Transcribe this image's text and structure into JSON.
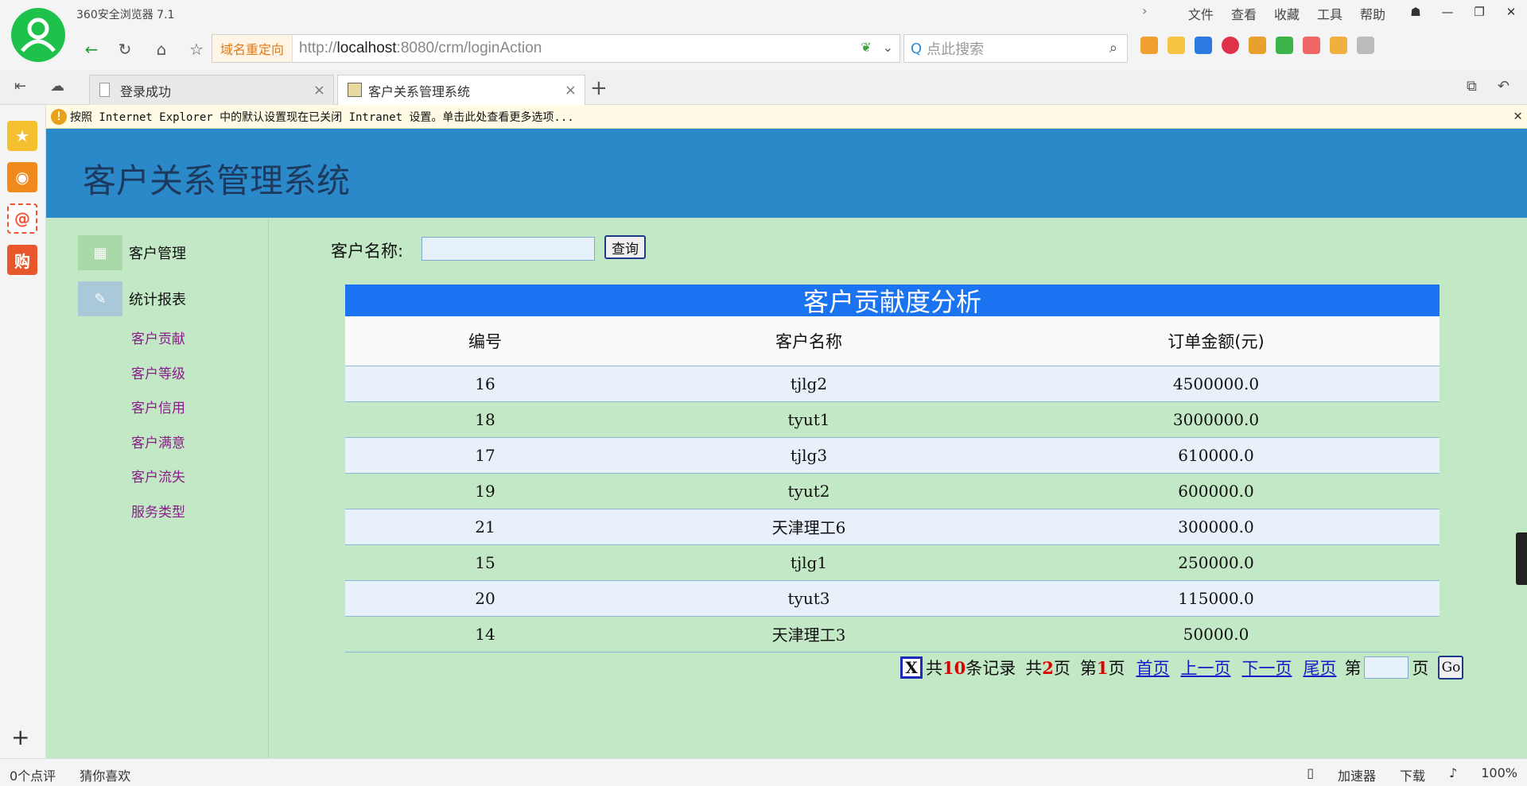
{
  "browser": {
    "app_title": "360安全浏览器 7.1",
    "menu": [
      "文件",
      "查看",
      "收藏",
      "工具",
      "帮助"
    ],
    "redirect_tag": "域名重定向",
    "url_prefix": "http://",
    "url_host": "localhost",
    "url_rest": ":8080/crm/loginAction",
    "search_placeholder": "点此搜索",
    "tabs": [
      {
        "label": "登录成功",
        "active": false
      },
      {
        "label": "客户关系管理系统",
        "active": true
      }
    ],
    "infobar_text": "按照 Internet Explorer 中的默认设置现在已关闭 Intranet 设置。单击此处查看更多选项..."
  },
  "page": {
    "title": "客户关系管理系统",
    "menu_groups": [
      {
        "label": "客户管理",
        "icon": "grid-icon"
      },
      {
        "label": "统计报表",
        "icon": "pencil-icon"
      }
    ],
    "sub_links": [
      "客户贡献",
      "客户等级",
      "客户信用",
      "客户满意",
      "客户流失",
      "服务类型"
    ],
    "search_label": "客户名称:",
    "query_button": "查询",
    "report_title": "客户贡献度分析",
    "columns": [
      "编号",
      "客户名称",
      "订单金额(元)"
    ],
    "rows": [
      [
        "16",
        "tjlg2",
        "4500000.0"
      ],
      [
        "18",
        "tyut1",
        "3000000.0"
      ],
      [
        "17",
        "tjlg3",
        "610000.0"
      ],
      [
        "19",
        "tyut2",
        "600000.0"
      ],
      [
        "21",
        "天津理工6",
        "300000.0"
      ],
      [
        "15",
        "tjlg1",
        "250000.0"
      ],
      [
        "20",
        "tyut3",
        "115000.0"
      ],
      [
        "14",
        "天津理工3",
        "50000.0"
      ]
    ],
    "pager": {
      "excel_icon_glyph": "X",
      "total_prefix": "共",
      "total_records": "10",
      "total_suffix": "条记录",
      "pages_prefix": "共",
      "total_pages": "2",
      "pages_suffix": "页",
      "current_prefix": "第",
      "current_page": "1",
      "current_suffix": "页",
      "first": "首页",
      "prev": "上一页",
      "next": "下一页",
      "last": "尾页",
      "jump_prefix": "第",
      "jump_suffix": "页",
      "go": "Go"
    }
  },
  "status": {
    "left": [
      "0个点评",
      "猜你喜欢"
    ],
    "right": [
      "加速器",
      "下载"
    ],
    "zoom": "100%"
  },
  "colors": {
    "header_blue": "#2b89c9",
    "page_green": "#c2e8c6",
    "report_title_blue": "#1a73f0",
    "sublink_purple": "#8b1a8b"
  }
}
